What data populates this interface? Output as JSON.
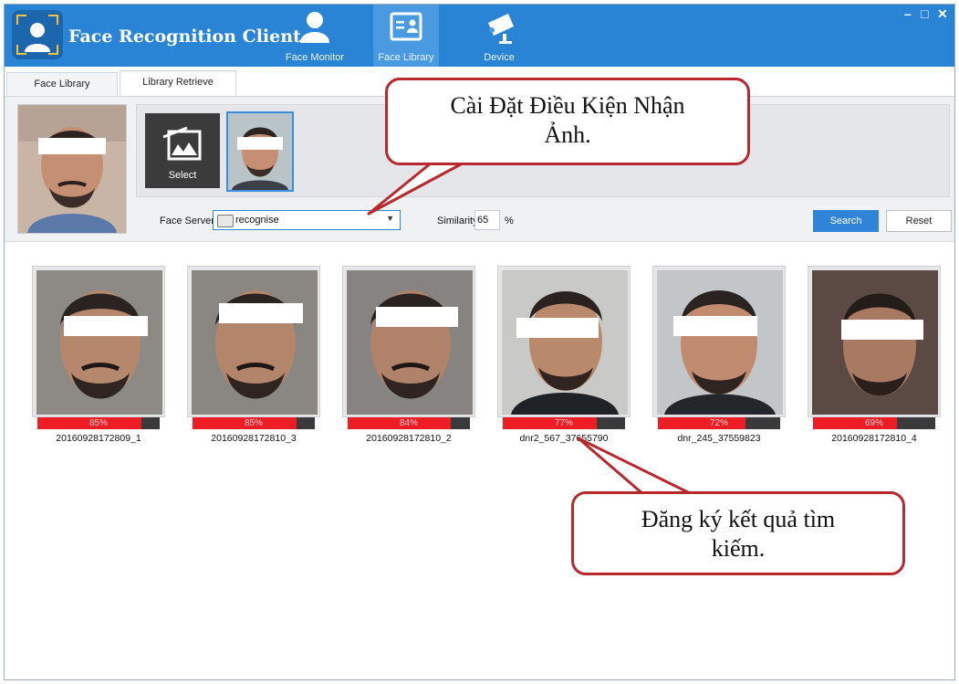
{
  "window": {
    "title": "Face Recognition Client",
    "controls": {
      "minimize": "–",
      "maximize": "□",
      "close": "✕"
    }
  },
  "nav": [
    {
      "label": "Face Monitor",
      "icon": "person-icon",
      "active": false
    },
    {
      "label": "Face Library",
      "icon": "id-card-icon",
      "active": true
    },
    {
      "label": "Device",
      "icon": "camera-icon",
      "active": false
    }
  ],
  "tabs": [
    {
      "label": "Face Library",
      "active": false
    },
    {
      "label": "Library Retrieve",
      "active": true
    }
  ],
  "query": {
    "select_label": "Select",
    "face_server_label": "Face Server:",
    "face_server_value": "recognise",
    "similarity_label": "Similarity:",
    "similarity_value": "65",
    "similarity_unit": "%",
    "search_label": "Search",
    "reset_label": "Reset"
  },
  "results": [
    {
      "score": "85%",
      "fraction": 0.85,
      "name": "20160928172809_1"
    },
    {
      "score": "85%",
      "fraction": 0.85,
      "name": "20160928172810_3"
    },
    {
      "score": "84%",
      "fraction": 0.84,
      "name": "20160928172810_2"
    },
    {
      "score": "77%",
      "fraction": 0.77,
      "name": "dnr2_567_37655790"
    },
    {
      "score": "72%",
      "fraction": 0.72,
      "name": "dnr_245_37559823"
    },
    {
      "score": "69%",
      "fraction": 0.69,
      "name": "20160928172810_4"
    }
  ],
  "annotations": {
    "callout1_line1": "Cài Đặt Điều Kiện Nhận",
    "callout1_line2": "Ảnh.",
    "callout2_line1": "Đăng ký kết quả tìm",
    "callout2_line2": "kiếm."
  },
  "colors": {
    "titlebar": "#2a84d6",
    "accent": "#2f84d8",
    "score_fill": "#ee1c24",
    "callout_border": "#b7282f"
  }
}
